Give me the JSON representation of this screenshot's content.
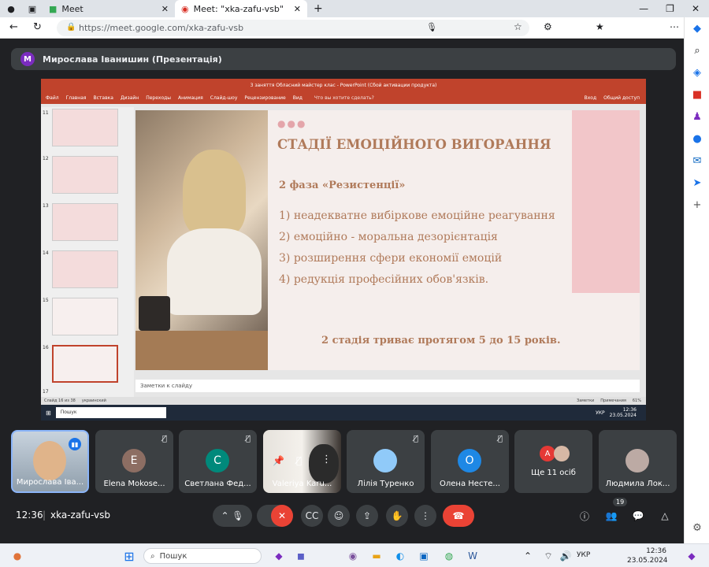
{
  "browser": {
    "tabs": [
      {
        "label": "Meet"
      },
      {
        "label": "Meet: \"xka-zafu-vsb\""
      }
    ],
    "url": "https://meet.google.com/xka-zafu-vsb"
  },
  "meet": {
    "presenter_initial": "M",
    "presenter_title": "Мирослава Іванишин (Презентація)",
    "time": "12:36",
    "meeting_code": "xka-zafu-vsb",
    "participants_count": "19",
    "participants": [
      {
        "name": "Мирослава Іва...",
        "initial": "",
        "color": "#7aa0c4"
      },
      {
        "name": "Elena Mokose...",
        "initial": "E",
        "color": "#8d6e63"
      },
      {
        "name": "Светлана Фед...",
        "initial": "C",
        "color": "#00897b"
      },
      {
        "name": "Valeriya Karu...",
        "initial": "",
        "color": "#555"
      },
      {
        "name": "Лілія Туренко",
        "initial": "",
        "color": "#90caf9"
      },
      {
        "name": "Олена Несте...",
        "initial": "O",
        "color": "#1e88e5"
      },
      {
        "name": "Ще 11 осіб",
        "initial": "A",
        "color": "#e53935"
      },
      {
        "name": "Людмила Лок...",
        "initial": "",
        "color": "#bcaaa4"
      }
    ]
  },
  "ppt": {
    "window_title": "3 заняття Обласний майстер клас - PowerPoint (Сбой активации продукта)",
    "menu": [
      "Файл",
      "Главная",
      "Вставка",
      "Дизайн",
      "Переходы",
      "Анимация",
      "Слайд-шоу",
      "Рецензирование",
      "Вид"
    ],
    "search_hint": "Что вы хотите сделать?",
    "login": "Вход",
    "share": "Общий доступ",
    "thumb_numbers": [
      "11",
      "12",
      "13",
      "14",
      "15",
      "16",
      "17"
    ],
    "notes_placeholder": "Заметки к слайду",
    "status_left": "Слайд 16 из 38",
    "status_lang": "украинский",
    "status_notes": "Заметки",
    "status_comments": "Примечания",
    "zoom": "61%",
    "inner_taskbar_search": "Пошук",
    "inner_time": "12:36",
    "inner_date": "23.05.2024",
    "inner_lang": "УКР"
  },
  "slide": {
    "title": "СТАДІЇ ЕМОЦІЙНОГО ВИГОРАННЯ",
    "phase": "2 фаза «Резистенції»",
    "items": [
      "1) неадекватне вибіркове емоційне реагування",
      "2) емоційно - моральна дезорієнтація",
      "3) розширення сфери економії емоцій",
      "4) редукція професійних обов'язків."
    ],
    "footer": "2 стадія триває протягом 5 до 15 років."
  },
  "taskbar": {
    "search": "Пошук",
    "lang": "УКР",
    "time": "12:36",
    "date": "23.05.2024"
  },
  "colors": {
    "ppt_red": "#c0432c",
    "slide_text": "#b07a5a",
    "pink_block": "#f2c6c9",
    "end_call": "#ea4335"
  }
}
